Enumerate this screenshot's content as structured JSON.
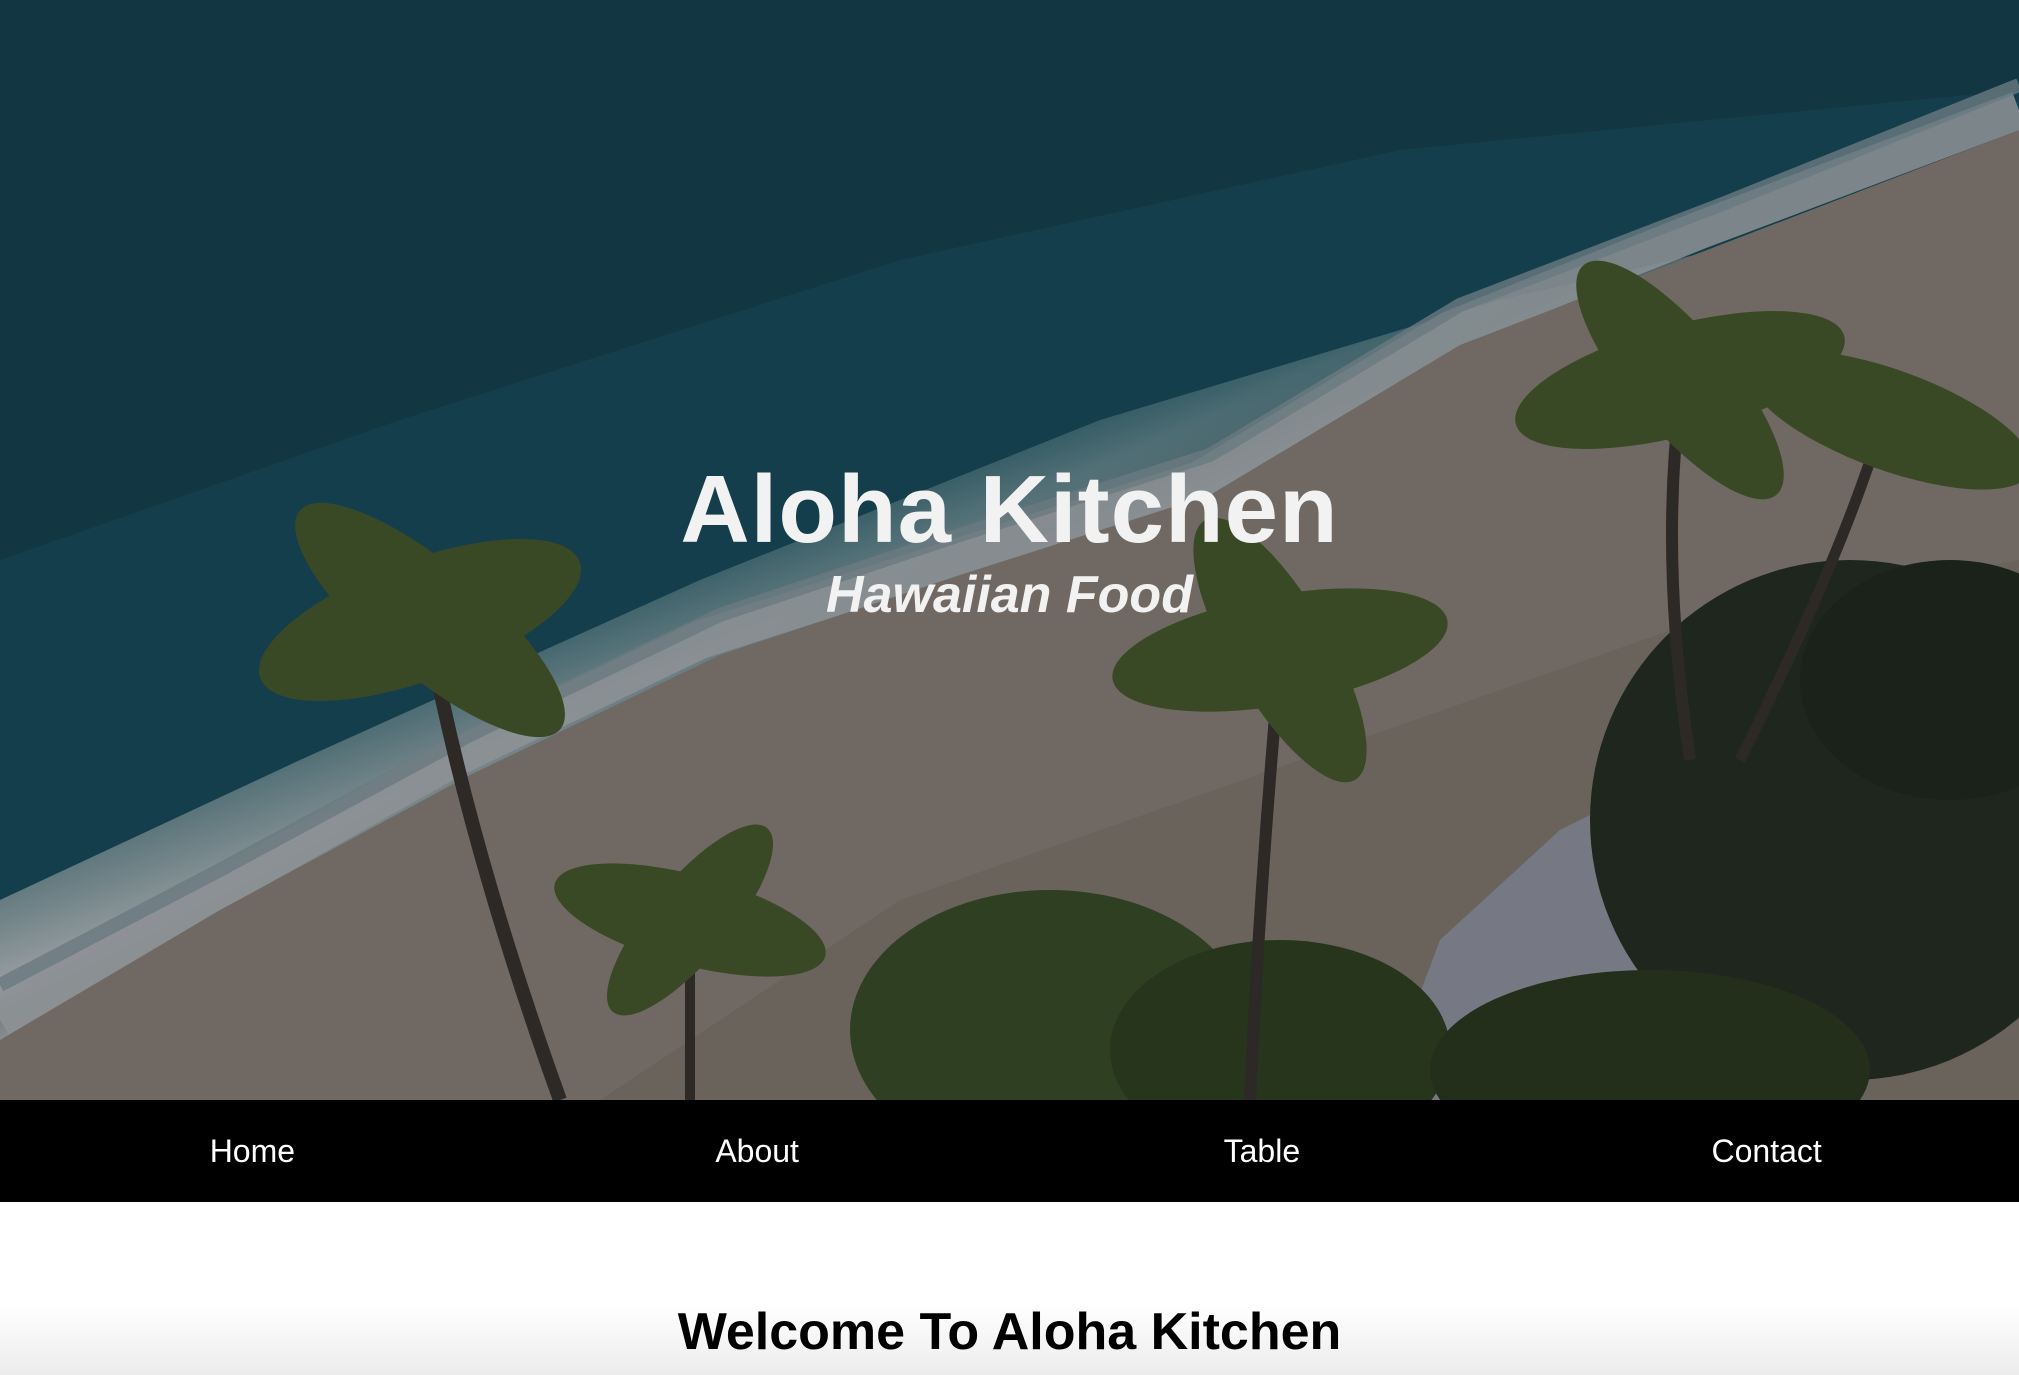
{
  "hero": {
    "title": "Aloha Kitchen",
    "subtitle": "Hawaiian Food",
    "background": "beach-with-palm-trees-image"
  },
  "nav": {
    "items": [
      {
        "label": "Home"
      },
      {
        "label": "About"
      },
      {
        "label": "Table"
      },
      {
        "label": "Contact"
      }
    ]
  },
  "main": {
    "heading": "Welcome To Aloha Kitchen"
  },
  "colors": {
    "nav_background": "#000000",
    "nav_text": "#ffffff",
    "hero_text": "#f2f2f2",
    "heading_text": "#000000"
  }
}
